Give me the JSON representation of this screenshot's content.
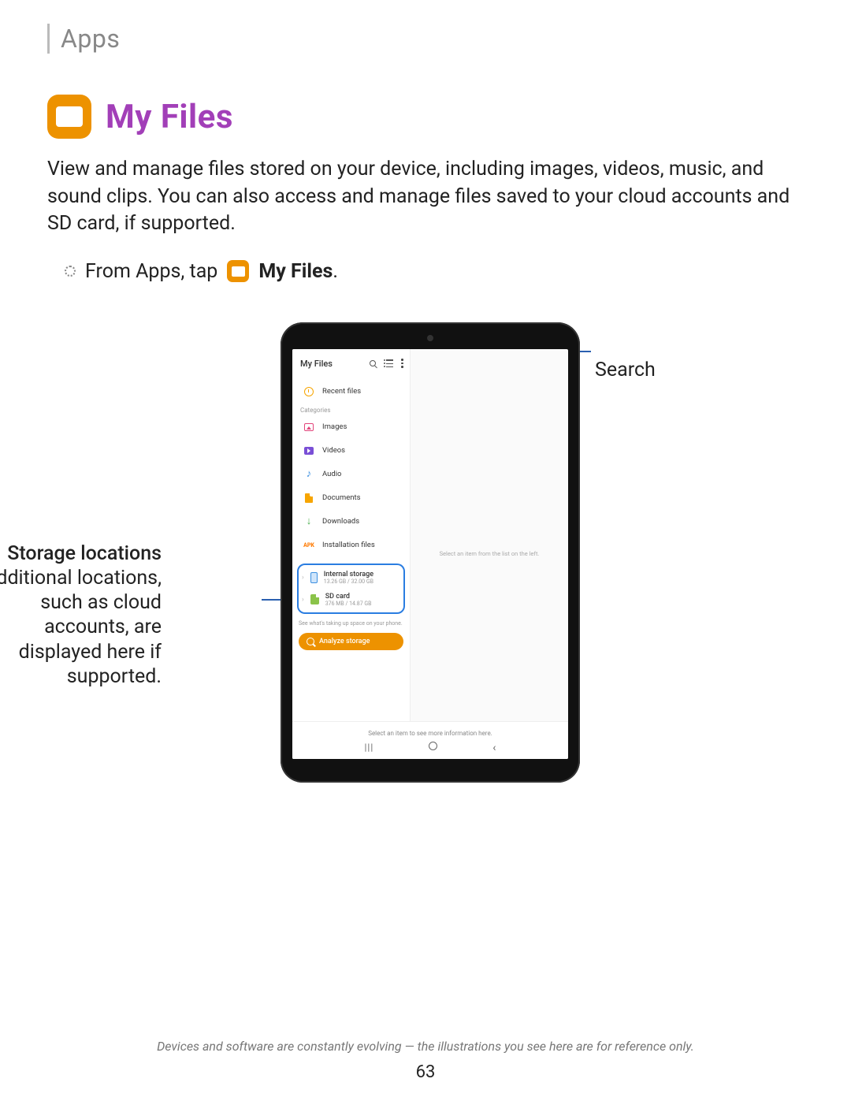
{
  "breadcrumb": "Apps",
  "title": "My Files",
  "intro": "View and manage files stored on your device, including images, videos, music, and sound clips. You can also access and manage files saved to your cloud accounts and SD card, if supported.",
  "step": {
    "prefix": "From Apps, tap",
    "app_name": "My Files",
    "suffix": "."
  },
  "callouts": {
    "search": "Search",
    "storage_title": "Storage locations",
    "storage_body": "Additional locations, such as cloud accounts, are displayed here if supported."
  },
  "device": {
    "app_title": "My Files",
    "recent_label": "Recent files",
    "categories_label": "Categories",
    "categories": [
      {
        "icon": "images-icon",
        "label": "Images"
      },
      {
        "icon": "videos-icon",
        "label": "Videos"
      },
      {
        "icon": "audio-icon",
        "label": "Audio"
      },
      {
        "icon": "documents-icon",
        "label": "Documents"
      },
      {
        "icon": "downloads-icon",
        "label": "Downloads"
      },
      {
        "icon": "apk-icon",
        "label": "Installation files"
      }
    ],
    "storage": [
      {
        "title": "Internal storage",
        "sub": "13.26 GB / 32.00 GB"
      },
      {
        "title": "SD card",
        "sub": "376 MB / 14.87 GB"
      }
    ],
    "hint": "See what's taking up space on your phone.",
    "analyze_label": "Analyze storage",
    "pane_placeholder": "Select an item from the list on the left.",
    "bottom_msg": "Select an item to see more information here."
  },
  "footnote": "Devices and software are constantly evolving — the illustrations you see here are for reference only.",
  "page_number": "63"
}
